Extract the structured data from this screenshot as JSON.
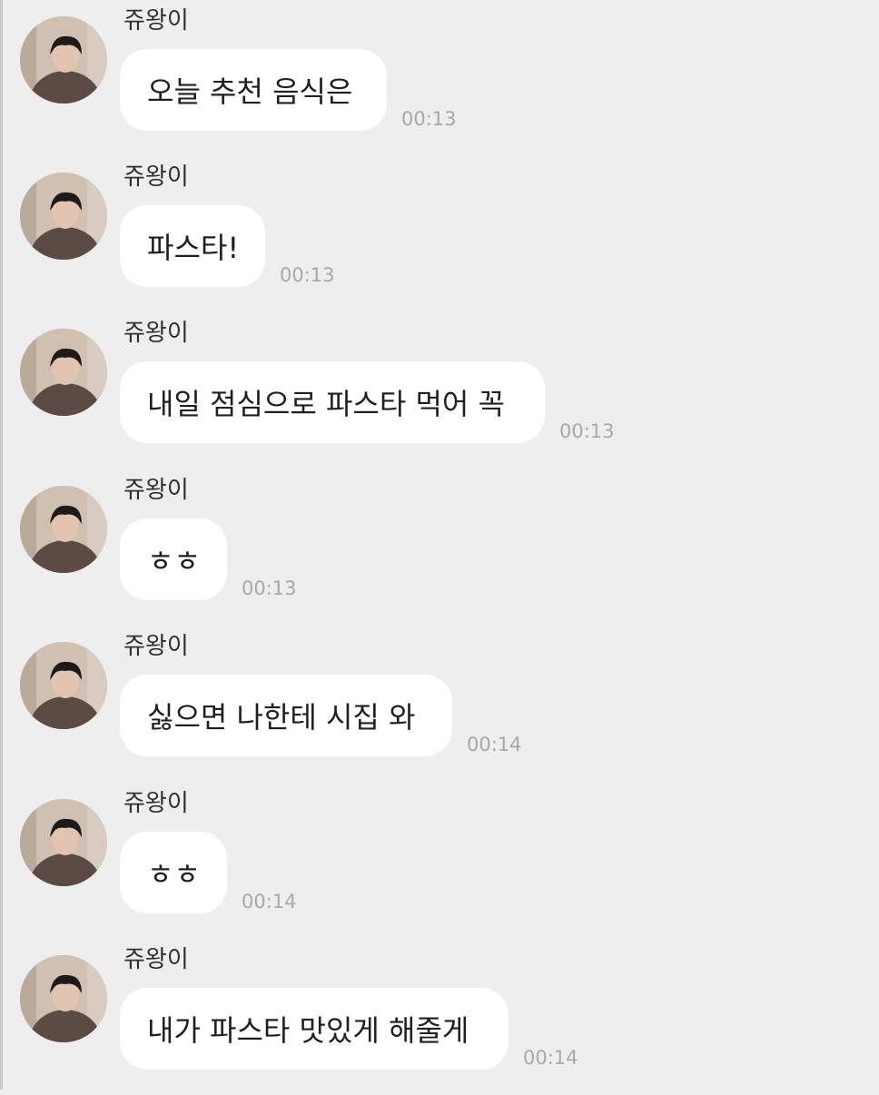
{
  "chat": {
    "messages": [
      {
        "sender": "쥬왕이",
        "text": "오늘 추천 음식은",
        "time": "00:13"
      },
      {
        "sender": "쥬왕이",
        "text": "파스타!",
        "time": "00:13"
      },
      {
        "sender": "쥬왕이",
        "text": "내일 점심으로 파스타 먹어 꼭",
        "time": "00:13"
      },
      {
        "sender": "쥬왕이",
        "text": "ㅎㅎ",
        "time": "00:13"
      },
      {
        "sender": "쥬왕이",
        "text": "싫으면 나한테 시집 와",
        "time": "00:14"
      },
      {
        "sender": "쥬왕이",
        "text": "ㅎㅎ",
        "time": "00:14"
      },
      {
        "sender": "쥬왕이",
        "text": "내가 파스타 맛있게 해줄게",
        "time": "00:14"
      }
    ]
  },
  "colors": {
    "background": "#eeeeee",
    "bubble": "#ffffff",
    "timestamp": "#a8a8a8"
  }
}
